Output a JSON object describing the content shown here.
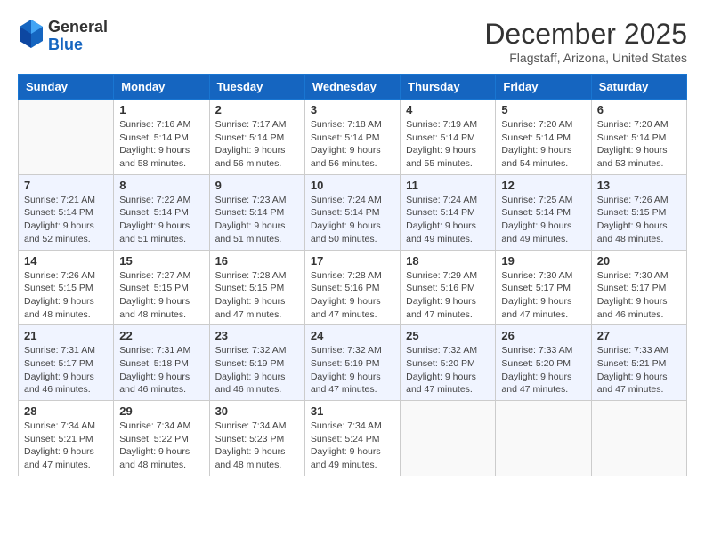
{
  "logo": {
    "general": "General",
    "blue": "Blue"
  },
  "title": "December 2025",
  "location": "Flagstaff, Arizona, United States",
  "days_of_week": [
    "Sunday",
    "Monday",
    "Tuesday",
    "Wednesday",
    "Thursday",
    "Friday",
    "Saturday"
  ],
  "weeks": [
    [
      {
        "day": "",
        "sunrise": "",
        "sunset": "",
        "daylight": ""
      },
      {
        "day": "1",
        "sunrise": "Sunrise: 7:16 AM",
        "sunset": "Sunset: 5:14 PM",
        "daylight": "Daylight: 9 hours and 58 minutes."
      },
      {
        "day": "2",
        "sunrise": "Sunrise: 7:17 AM",
        "sunset": "Sunset: 5:14 PM",
        "daylight": "Daylight: 9 hours and 56 minutes."
      },
      {
        "day": "3",
        "sunrise": "Sunrise: 7:18 AM",
        "sunset": "Sunset: 5:14 PM",
        "daylight": "Daylight: 9 hours and 56 minutes."
      },
      {
        "day": "4",
        "sunrise": "Sunrise: 7:19 AM",
        "sunset": "Sunset: 5:14 PM",
        "daylight": "Daylight: 9 hours and 55 minutes."
      },
      {
        "day": "5",
        "sunrise": "Sunrise: 7:20 AM",
        "sunset": "Sunset: 5:14 PM",
        "daylight": "Daylight: 9 hours and 54 minutes."
      },
      {
        "day": "6",
        "sunrise": "Sunrise: 7:20 AM",
        "sunset": "Sunset: 5:14 PM",
        "daylight": "Daylight: 9 hours and 53 minutes."
      }
    ],
    [
      {
        "day": "7",
        "sunrise": "Sunrise: 7:21 AM",
        "sunset": "Sunset: 5:14 PM",
        "daylight": "Daylight: 9 hours and 52 minutes."
      },
      {
        "day": "8",
        "sunrise": "Sunrise: 7:22 AM",
        "sunset": "Sunset: 5:14 PM",
        "daylight": "Daylight: 9 hours and 51 minutes."
      },
      {
        "day": "9",
        "sunrise": "Sunrise: 7:23 AM",
        "sunset": "Sunset: 5:14 PM",
        "daylight": "Daylight: 9 hours and 51 minutes."
      },
      {
        "day": "10",
        "sunrise": "Sunrise: 7:24 AM",
        "sunset": "Sunset: 5:14 PM",
        "daylight": "Daylight: 9 hours and 50 minutes."
      },
      {
        "day": "11",
        "sunrise": "Sunrise: 7:24 AM",
        "sunset": "Sunset: 5:14 PM",
        "daylight": "Daylight: 9 hours and 49 minutes."
      },
      {
        "day": "12",
        "sunrise": "Sunrise: 7:25 AM",
        "sunset": "Sunset: 5:14 PM",
        "daylight": "Daylight: 9 hours and 49 minutes."
      },
      {
        "day": "13",
        "sunrise": "Sunrise: 7:26 AM",
        "sunset": "Sunset: 5:15 PM",
        "daylight": "Daylight: 9 hours and 48 minutes."
      }
    ],
    [
      {
        "day": "14",
        "sunrise": "Sunrise: 7:26 AM",
        "sunset": "Sunset: 5:15 PM",
        "daylight": "Daylight: 9 hours and 48 minutes."
      },
      {
        "day": "15",
        "sunrise": "Sunrise: 7:27 AM",
        "sunset": "Sunset: 5:15 PM",
        "daylight": "Daylight: 9 hours and 48 minutes."
      },
      {
        "day": "16",
        "sunrise": "Sunrise: 7:28 AM",
        "sunset": "Sunset: 5:15 PM",
        "daylight": "Daylight: 9 hours and 47 minutes."
      },
      {
        "day": "17",
        "sunrise": "Sunrise: 7:28 AM",
        "sunset": "Sunset: 5:16 PM",
        "daylight": "Daylight: 9 hours and 47 minutes."
      },
      {
        "day": "18",
        "sunrise": "Sunrise: 7:29 AM",
        "sunset": "Sunset: 5:16 PM",
        "daylight": "Daylight: 9 hours and 47 minutes."
      },
      {
        "day": "19",
        "sunrise": "Sunrise: 7:30 AM",
        "sunset": "Sunset: 5:17 PM",
        "daylight": "Daylight: 9 hours and 47 minutes."
      },
      {
        "day": "20",
        "sunrise": "Sunrise: 7:30 AM",
        "sunset": "Sunset: 5:17 PM",
        "daylight": "Daylight: 9 hours and 46 minutes."
      }
    ],
    [
      {
        "day": "21",
        "sunrise": "Sunrise: 7:31 AM",
        "sunset": "Sunset: 5:17 PM",
        "daylight": "Daylight: 9 hours and 46 minutes."
      },
      {
        "day": "22",
        "sunrise": "Sunrise: 7:31 AM",
        "sunset": "Sunset: 5:18 PM",
        "daylight": "Daylight: 9 hours and 46 minutes."
      },
      {
        "day": "23",
        "sunrise": "Sunrise: 7:32 AM",
        "sunset": "Sunset: 5:19 PM",
        "daylight": "Daylight: 9 hours and 46 minutes."
      },
      {
        "day": "24",
        "sunrise": "Sunrise: 7:32 AM",
        "sunset": "Sunset: 5:19 PM",
        "daylight": "Daylight: 9 hours and 47 minutes."
      },
      {
        "day": "25",
        "sunrise": "Sunrise: 7:32 AM",
        "sunset": "Sunset: 5:20 PM",
        "daylight": "Daylight: 9 hours and 47 minutes."
      },
      {
        "day": "26",
        "sunrise": "Sunrise: 7:33 AM",
        "sunset": "Sunset: 5:20 PM",
        "daylight": "Daylight: 9 hours and 47 minutes."
      },
      {
        "day": "27",
        "sunrise": "Sunrise: 7:33 AM",
        "sunset": "Sunset: 5:21 PM",
        "daylight": "Daylight: 9 hours and 47 minutes."
      }
    ],
    [
      {
        "day": "28",
        "sunrise": "Sunrise: 7:34 AM",
        "sunset": "Sunset: 5:21 PM",
        "daylight": "Daylight: 9 hours and 47 minutes."
      },
      {
        "day": "29",
        "sunrise": "Sunrise: 7:34 AM",
        "sunset": "Sunset: 5:22 PM",
        "daylight": "Daylight: 9 hours and 48 minutes."
      },
      {
        "day": "30",
        "sunrise": "Sunrise: 7:34 AM",
        "sunset": "Sunset: 5:23 PM",
        "daylight": "Daylight: 9 hours and 48 minutes."
      },
      {
        "day": "31",
        "sunrise": "Sunrise: 7:34 AM",
        "sunset": "Sunset: 5:24 PM",
        "daylight": "Daylight: 9 hours and 49 minutes."
      },
      {
        "day": "",
        "sunrise": "",
        "sunset": "",
        "daylight": ""
      },
      {
        "day": "",
        "sunrise": "",
        "sunset": "",
        "daylight": ""
      },
      {
        "day": "",
        "sunrise": "",
        "sunset": "",
        "daylight": ""
      }
    ]
  ]
}
